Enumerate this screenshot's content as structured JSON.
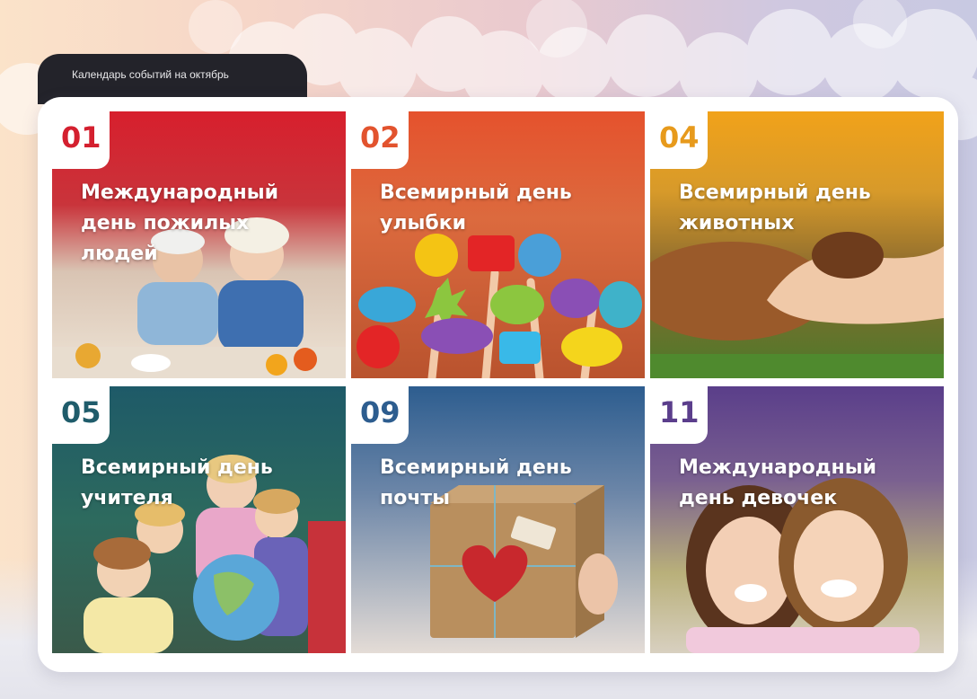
{
  "header": {
    "title": "Календарь событий на октябрь"
  },
  "events": [
    {
      "day": "01",
      "name": "Международный день пожилых людей",
      "color": "#d4202f"
    },
    {
      "day": "02",
      "name": "Всемирный день улыбки",
      "color": "#e2532e"
    },
    {
      "day": "04",
      "name": "Всемирный день животных",
      "color": "#e79a1c"
    },
    {
      "day": "05",
      "name": "Всемирный день учителя",
      "color": "#1f5c6b"
    },
    {
      "day": "09",
      "name": "Всемирный день почты",
      "color": "#2d5d8f"
    },
    {
      "day": "11",
      "name": "Международный день девочек",
      "color": "#5b3e8c"
    }
  ]
}
